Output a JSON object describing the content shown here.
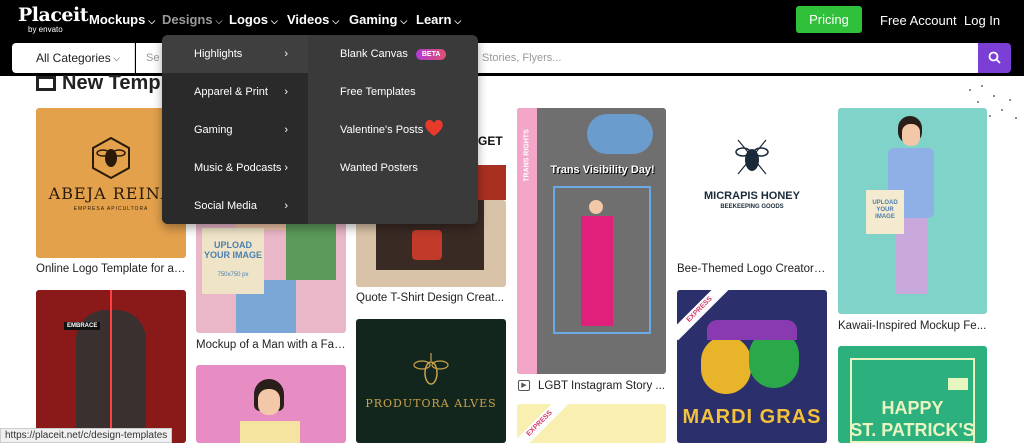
{
  "brand": {
    "name": "Placeit",
    "sub": "by envato"
  },
  "nav": {
    "items": [
      {
        "label": "Mockups"
      },
      {
        "label": "Designs"
      },
      {
        "label": "Logos"
      },
      {
        "label": "Videos"
      },
      {
        "label": "Gaming"
      },
      {
        "label": "Learn"
      }
    ],
    "pricing": "Pricing",
    "free_account": "Free Account",
    "login": "Log In"
  },
  "search": {
    "category": "All Categories",
    "placeholder_start": "Se",
    "placeholder_end": "Stories, Flyers..."
  },
  "heading": "New Temp",
  "dropdown": {
    "left": [
      {
        "label": "Highlights"
      },
      {
        "label": "Apparel & Print"
      },
      {
        "label": "Gaming"
      },
      {
        "label": "Music & Podcasts"
      },
      {
        "label": "Social Media"
      }
    ],
    "right": [
      {
        "label": "Blank Canvas",
        "badge": "BETA"
      },
      {
        "label": "Free Templates"
      },
      {
        "label": "Valentine's Posts"
      },
      {
        "label": "Wanted Posters"
      }
    ]
  },
  "cards": {
    "abeja": {
      "title": "ABEJA REINA",
      "subtitle": "EMPRESA APICULTORA",
      "caption": "Online Logo Template for a ..."
    },
    "man": {
      "tote_text": "UPLOAD YOUR IMAGE",
      "tote_size": "750x750 px",
      "caption": "Mockup of a Man with a Fac..."
    },
    "quote": {
      "partial": "GET",
      "caption": "Quote T-Shirt Design Creat..."
    },
    "trans": {
      "banner": "Trans Visibility Day!",
      "side": "TRANS RIGHTS",
      "caption": "LGBT Instagram Story ..."
    },
    "micrapis": {
      "title": "MICRAPIS HONEY",
      "subtitle": "BEEKEEPING GOODS",
      "caption": "Bee-Themed Logo Creator f..."
    },
    "kawaii": {
      "tote_text": "UPLOAD YOUR IMAGE",
      "caption": "Kawaii-Inspired Mockup Fe..."
    },
    "knight": {
      "label": "EMBRACE"
    },
    "productora": {
      "title": "PRODUTORA ALVES"
    },
    "mardigras": {
      "ribbon": "EXPRESS",
      "title": "MARDI GRAS"
    },
    "stpatrick": {
      "line1": "HAPPY",
      "line2": "ST. PATRICK'S"
    },
    "express2": {
      "ribbon": "EXPRESS"
    }
  },
  "status_url": "https://placeit.net/c/design-templates",
  "colors": {
    "accent": "#30c03a",
    "search_button": "#7b3fd6"
  }
}
